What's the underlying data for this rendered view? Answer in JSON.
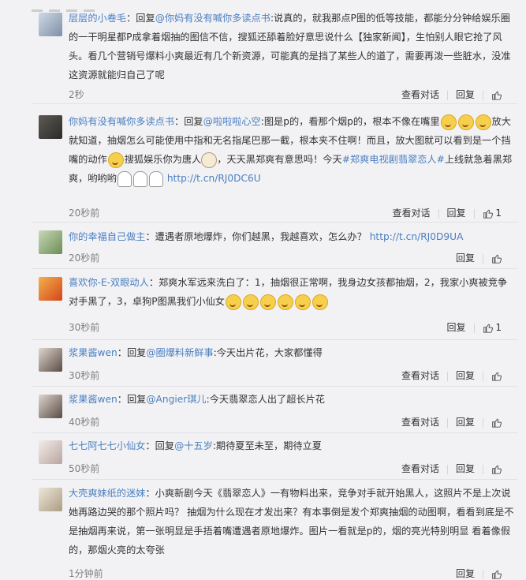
{
  "comments": [
    {
      "user": "层层的小卷毛",
      "reply_prefix": "：回复",
      "mention": "@你妈有没有喊你多读点书",
      "text1": ":说真的，就我那点P图的低等技能，都能分分钟给娱乐圈的一干明星都P成拿着烟抽的图信不信，搜狐还舔着脸好意思说什么【独家新闻】，生怕别人眼它抢了风头。看几个营销号爆料小爽最近有几个新资源，可能真的是挡了某些人的道了，需要再泼一些脏水，没准这资源就能归自己了呢",
      "time": "2秒",
      "view": "查看对话",
      "reply": "回复"
    },
    {
      "user": "你妈有没有喊你多读点书",
      "reply_prefix": "：回复",
      "mention": "@啦啦啦心空",
      "text1": ":图是p的，看那个烟p的，根本不像在嘴里",
      "text2": "放大就知道，抽烟怎么可能使用中指和无名指尾巴那一截，根本夹不住啊！而且，放大图就可以看到是一个挡嘴的动作",
      "text3": "搜狐娱乐你为唐人",
      "text4": "，天天黑郑爽有意思吗！今天",
      "topic": "#郑爽电视剧翡翠恋人#",
      "text5": "上线就急着黑郑爽，哟哟哟",
      "url": "http://t.cn/RJ0DC6U",
      "time": "20秒前",
      "view": "查看对话",
      "reply": "回复",
      "likes": "1"
    },
    {
      "user": "你的幸福自己做主",
      "text1": "：遭遇者原地爆炸，你们越黑，我越喜欢，怎么办？",
      "url": "http://t.cn/RJ0D9UA",
      "time": "20秒前",
      "reply": "回复"
    },
    {
      "user": "喜欢你-E-双眼动人",
      "text1": "：郑爽水军远来洗白了：1，抽烟很正常啊，我身边女孩都抽烟，2，我家小爽被竞争对手黑了，3，卓狗P图黑我们小仙女",
      "time": "30秒前",
      "reply": "回复",
      "likes": "1"
    },
    {
      "user": "浆果酱wen",
      "reply_prefix": "：回复",
      "mention": "@圈爆料新鲜事",
      "text1": ":今天出片花，大家都懂得",
      "time": "30秒前",
      "view": "查看对话",
      "reply": "回复"
    },
    {
      "user": "浆果酱wen",
      "reply_prefix": "：回复",
      "mention": "@Angier琪儿",
      "text1": ":今天翡翠恋人出了超长片花",
      "time": "40秒前",
      "view": "查看对话",
      "reply": "回复"
    },
    {
      "user": "七七阿七七小仙女",
      "reply_prefix": "：回复",
      "mention": "@十五岁",
      "text1": ":期待夏至未至，期待立夏",
      "time": "50秒前",
      "view": "查看对话",
      "reply": "回复"
    },
    {
      "user": "大壳爽妹纸的迷妹",
      "text1": "：小爽新剧今天《翡翠恋人》一有物料出来，竞争对手就开始黑人，这照片不是上次说她再路边哭的那个照片吗？ 抽烟为什么现在才发出来？有本事倒是发个郑爽抽烟的动图啊，看看到底是不是抽烟再来说，第一张明显是手捂着嘴遭遇者原地爆炸。图片一看就是p的，烟的亮光特别明显 看着像假的，那烟火亮的太夸张",
      "time": "1分钟前",
      "reply": "回复"
    }
  ],
  "icons": {
    "like": "thumbs-up-icon",
    "avatar": "user-avatar"
  },
  "colors": {
    "link": "#4a7fc0",
    "background": "#f2f2f5",
    "time": "#808080"
  }
}
